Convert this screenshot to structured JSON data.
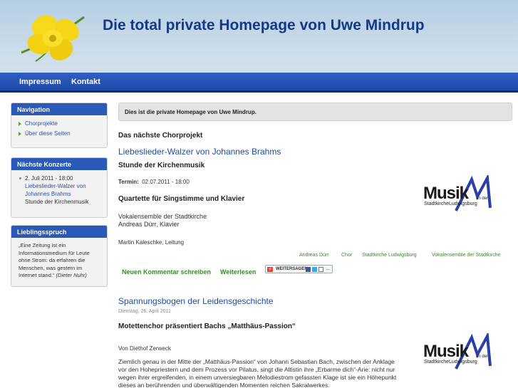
{
  "header": {
    "site_title": "Die total private Homepage von Uwe Mindrup"
  },
  "nav": {
    "items": [
      "Impressum",
      "Kontakt"
    ]
  },
  "sidebar": {
    "navigation": {
      "title": "Navigation",
      "items": [
        "Chorprojekte",
        "Über diese Seiten"
      ]
    },
    "concerts": {
      "title": "Nächste Konzerte",
      "date": "2. Juli 2011 - 18:00",
      "link": "Liebeslieder-Walzer von Johannes Brahms",
      "text": "Stunde der Kirchenmusik"
    },
    "quote": {
      "title": "Lieblingsspruch",
      "text": "„Eine Zeitung ist ein Informationsmedium für Leute ohne Strom: da erfahren die Menschen, was gestern im Internet stand.“",
      "author": "(Dieter Nuhr)"
    }
  },
  "main": {
    "notice": "Dies ist die private Homepage von Uwe Mindrup.",
    "section_title": "Das nächste Chorprojekt",
    "article1": {
      "title": "Liebeslieder-Walzer von Johannes Brahms",
      "subtitle": "Stunde der Kirchenmusik",
      "termin_label": "Termin:",
      "termin_value": "02.07.2011 - 18:00",
      "heading2": "Quartette für Singstimme und Klavier",
      "line1": "Vokalensemble der Stadtkirche",
      "line2": "Andreas Dürr, Klavier",
      "line3": "Martin Kaleschke, Leitung",
      "tags": [
        "Andreas Dürr",
        "Chor",
        "Stadtkirche Ludwigsburg",
        "Vokalensemble der Stadtkirche"
      ],
      "comment_link": "Neuen Kommentar schreiben",
      "read_link": "Weiterlesen",
      "share_label": "WEITERSAGEN"
    },
    "article2": {
      "title": "Spannungsbogen der Leidensgeschichte",
      "date": "Dienstag, 26. April 2011",
      "subtitle": "Motettenchor präsentiert Bachs „Matthäus-Passion“",
      "author": "Von Diethof Zerweck",
      "body1": "Ziemlich genau in der Mitte der „Matthäus-Passion“ von Johann Sebastian Bach, zwischen der Anklage",
      "body2": "vor den Hohepriestern und dem Prozess vor Pilatus, singt die Altistin ihre „Erbarme dich“-Arie: nicht nur",
      "body3": "wegen ihrer ergreifenden, in einem unversiegbaren Melodiestrom gefassten Klage ist sie ein Höhepunkt",
      "body4": "dieses an berührenden und überwältigenden Momenten reichen Sakralwerkes."
    },
    "logo": {
      "big": "Musik",
      "small": "StadtkircheLudwigsburg",
      "tiny": "an der"
    }
  }
}
